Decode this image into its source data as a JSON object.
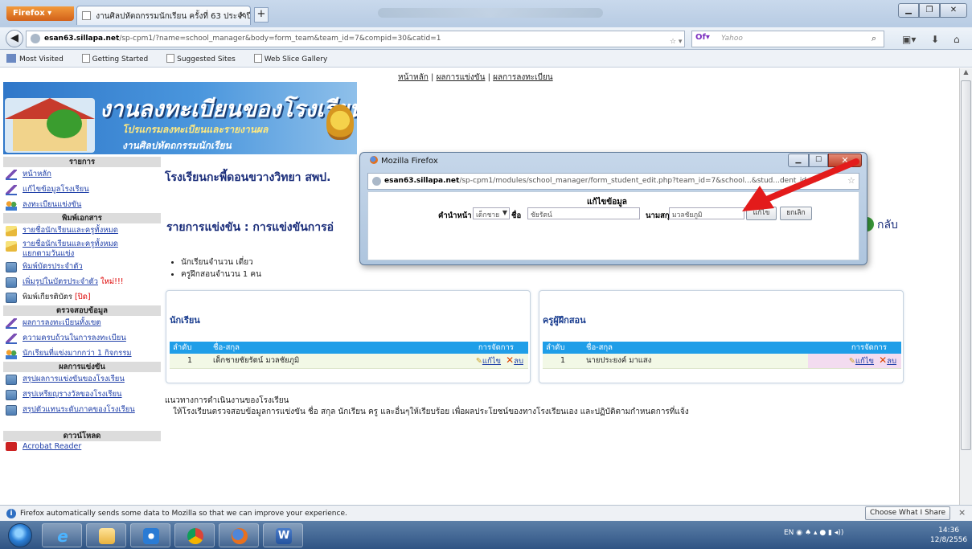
{
  "browser": {
    "menu_label": "Firefox ▾",
    "tab_title": "งานศิลปหัตถกรรมนักเรียน ครั้งที่ 63 ประจำปี...",
    "new_tab_symbol": "+",
    "url_domain": "esan63.sillapa.net",
    "url_path": "/sp-cpm1/?name=school_manager&body=form_team&team_id=7&compid=30&catid=1",
    "url_right_symbols": "☆ ▾ C",
    "search_engine": "Of▾",
    "search_placeholder": "Yahoo",
    "bookmarks": [
      "Most Visited",
      "Getting Started",
      "Suggested Sites",
      "Web Slice Gallery"
    ]
  },
  "page": {
    "top_links": [
      "หน้าหลัก",
      "ผลการแข่งขัน",
      "ผลการลงทะเบียน"
    ],
    "banner": {
      "title": "งานลงทะเบียนของโรงเรียน",
      "subtitle1": "โปรแกรมลงทะเบียนและรายงานผล",
      "subtitle2": "งานศิลปหัตถกรรมนักเรียน"
    },
    "sidebar": {
      "section_menu": "รายการ",
      "section_print": "พิมพ์เอกสาร",
      "section_check": "ตรวจสอบข้อมูล",
      "section_results": "ผลการแข่งขัน",
      "section_download": "ดาวน์โหลด",
      "items_menu": [
        "หน้าหลัก",
        "แก้ไขข้อมูลโรงเรียน",
        "ลงทะเบียนแข่งขัน"
      ],
      "items_print": [
        "รายชื่อนักเรียนและครูทั้งหมด",
        "รายชื่อนักเรียนและครูทั้งหมด",
        "แยกตามวันแข่ง",
        "พิมพ์บัตรประจำตัว",
        "เพิ่มรูปในบัตรประจำตัว",
        "ใหม่!!!",
        "พิมพ์เกียรติบัตร",
        "[ปิด]"
      ],
      "items_check": [
        "ผลการลงทะเบียนทั้งเขต",
        "ความครบถ้วนในการลงทะเบียน",
        "นักเรียนที่แข่งมากกว่า 1 กิจกรรม"
      ],
      "items_results": [
        "สรุปผลการแข่งขันของโรงเรียน",
        "สรุปเหรียญรางวัลของโรงเรียน",
        "สรุปตัวแทนระดับภาคของโรงเรียน"
      ],
      "items_download": [
        "Acrobat Reader"
      ]
    },
    "school_name": "โรงเรียนกะพี้ดอนขวางวิทยา สพป.",
    "contest_title": "รายการแข่งขัน : การแข่งขันการอ่",
    "back_label": "กลับ",
    "summary": [
      "นักเรียนจำนวน เดี่ยว",
      "ครูฝึกสอนจำนวน 1 คน"
    ],
    "students_panel": {
      "title": "นักเรียน",
      "headers": [
        "ลำดับ",
        "ชื่อ-สกุล",
        "การจัดการ"
      ],
      "rows": [
        {
          "no": "1",
          "name": "เด็กชายชัยรัตน์   มวลชัยภูมิ",
          "edit": "แก้ไข",
          "delete": "ลบ"
        }
      ]
    },
    "teachers_panel": {
      "title": "ครูผู้ฝึกสอน",
      "headers": [
        "ลำดับ",
        "ชื่อ-สกุล",
        "การจัดการ"
      ],
      "rows": [
        {
          "no": "1",
          "name": "นายประยงค์   มาแสง",
          "edit": "แก้ไข",
          "delete": "ลบ"
        }
      ]
    },
    "guide_title": "แนวทางการดำเนินงานของโรงเรียน",
    "guide_text": "ให้โรงเรียนตรวจสอบข้อมูลการแข่งขัน ชื่อ สกุล นักเรียน ครู และอื่นๆให้เรียบร้อย เพื่อผลประโยชน์ของทางโรงเรียนเอง และปฏิบัติตามกำหนดการที่แจ้ง"
  },
  "dialog": {
    "title": "Mozilla Firefox",
    "url_domain": "esan63.sillapa.net",
    "url_path": "/sp-cpm1/modules/school_manager/form_student_edit.php?team_id=7&school...&stud...dent_id=5",
    "heading": "แก้ไขข้อมูล",
    "label_prefix": "คำนำหน้า",
    "prefix_value": "เด็กชาย",
    "label_first": "ชื่อ",
    "first_value": "ชัยรัตน์",
    "label_last": "นามสกุล",
    "last_value": "มวลชัยภูมิ",
    "btn_edit": "แก้ไข",
    "btn_cancel": "ยกเลิก"
  },
  "notification": {
    "text": "Firefox automatically sends some data to Mozilla so that we can improve your experience.",
    "choose_label": "Choose What I Share",
    "close_symbol": "×"
  },
  "taskbar": {
    "word_label": "W",
    "tray_text": "EN",
    "time": "14:36",
    "date": "12/8/2556"
  },
  "colors": {
    "header_blue": "#1f9ee8",
    "link_blue": "#1f3fa8",
    "title_navy": "#1a2d7a",
    "annotation_arrow": "#e31b1b"
  }
}
